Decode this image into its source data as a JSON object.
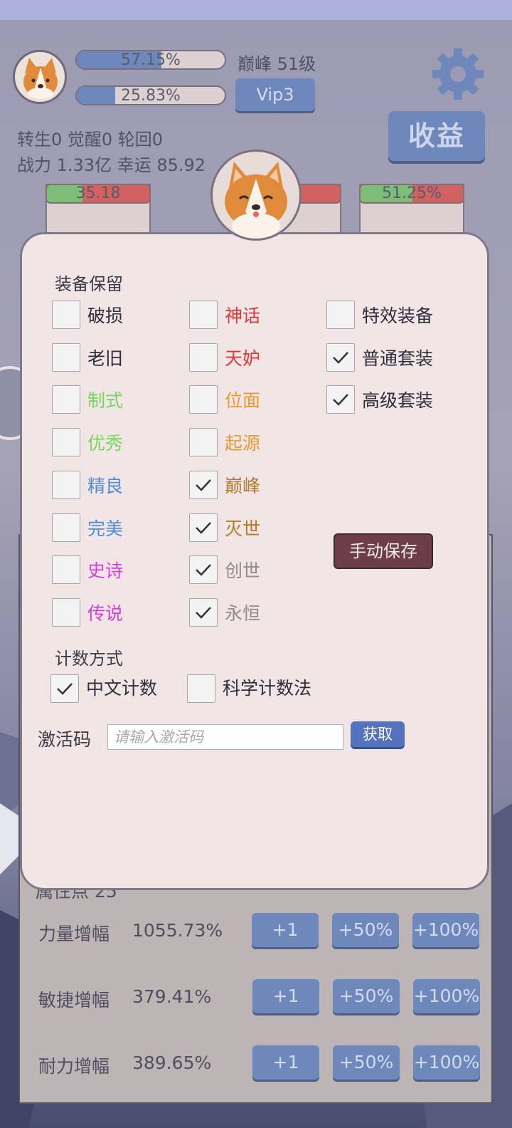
{
  "hud": {
    "exp_bar": {
      "text": "57.15%",
      "fill": 0.5715
    },
    "second_bar": {
      "text": "25.83%",
      "fill": 0.2583
    },
    "level_text": "巅峰 51级",
    "vip_label": "Vip3",
    "income_label": "收益",
    "stats_line1": "转生0 觉醒0 轮回0",
    "stats_line2": "战力 1.33亿  幸运 85.92",
    "hp_bars": [
      {
        "text": "35.18",
        "fill": 0.35
      },
      {
        "text": "%",
        "fill": 0.0
      },
      {
        "text": "51.25%",
        "fill": 0.5125
      }
    ]
  },
  "dialog": {
    "section_equipment": "装备保留",
    "columns": [
      [
        {
          "label": "破损",
          "color": "#2f2f3c",
          "checked": false
        },
        {
          "label": "老旧",
          "color": "#2f2f3c",
          "checked": false
        },
        {
          "label": "制式",
          "color": "#79d65a",
          "checked": false
        },
        {
          "label": "优秀",
          "color": "#79d65a",
          "checked": false
        },
        {
          "label": "精良",
          "color": "#4f8bd6",
          "checked": false
        },
        {
          "label": "完美",
          "color": "#4f8bd6",
          "checked": false
        },
        {
          "label": "史诗",
          "color": "#d63ed6",
          "checked": false
        },
        {
          "label": "传说",
          "color": "#d63ed6",
          "checked": false
        }
      ],
      [
        {
          "label": "神话",
          "color": "#d83a3a",
          "checked": false
        },
        {
          "label": "天妒",
          "color": "#d83a3a",
          "checked": false
        },
        {
          "label": "位面",
          "color": "#e89a2e",
          "checked": false
        },
        {
          "label": "起源",
          "color": "#e89a2e",
          "checked": false
        },
        {
          "label": "巅峰",
          "color": "#b07a2c",
          "checked": true
        },
        {
          "label": "灭世",
          "color": "#b07a2c",
          "checked": true
        },
        {
          "label": "创世",
          "color": "#8e8e8e",
          "checked": true
        },
        {
          "label": "永恒",
          "color": "#8e8e8e",
          "checked": true
        }
      ],
      [
        {
          "label": "特效装备",
          "color": "#2f2f3c",
          "checked": false
        },
        {
          "label": "普通套装",
          "color": "#2f2f3c",
          "checked": true
        },
        {
          "label": "高级套装",
          "color": "#2f2f3c",
          "checked": true
        }
      ]
    ],
    "save_button": "手动保存",
    "section_count": "计数方式",
    "count_options": [
      {
        "label": "中文计数",
        "checked": true
      },
      {
        "label": "科学计数法",
        "checked": false
      }
    ],
    "activation_label": "激活码",
    "activation_placeholder": "请输入激活码",
    "get_button": "获取"
  },
  "attributes": {
    "header_partial": "属性点 25",
    "rows": [
      {
        "name": "力量增幅",
        "value": "1055.73%"
      },
      {
        "name": "敏捷增幅",
        "value": "379.41%"
      },
      {
        "name": "耐力增幅",
        "value": "389.65%"
      }
    ],
    "buttons": [
      "+1",
      "+50%",
      "+100%"
    ]
  },
  "icons": [
    "avatar-corgi",
    "gear-icon",
    "checkmark-icon"
  ]
}
